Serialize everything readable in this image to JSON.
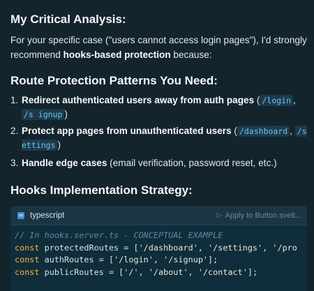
{
  "heading1": "My Critical Analysis:",
  "intro": {
    "before": "For your specific case (\"users cannot access login pages\"), I'd strongly recommend ",
    "bold": "hooks-based protection",
    "after": " because:"
  },
  "heading2": "Route Protection Patterns You Need:",
  "list": [
    {
      "num": "1.",
      "bold": "Redirect authenticated users away from auth pages",
      "open": " (",
      "code1": "/login",
      "sep": ", ",
      "code2": "/s ignup",
      "close": ")"
    },
    {
      "num": "2.",
      "bold": "Protect app pages from unauthenticated users",
      "open": " (",
      "code1": "/dashboard",
      "sep": ", ",
      "code2": "/s ettings",
      "close": ")"
    },
    {
      "num": "3.",
      "bold": "Handle edge cases",
      "rest": " (email verification, password reset, etc.)"
    }
  ],
  "heading3": "Hooks Implementation Strategy:",
  "code_block": {
    "language": "typescript",
    "apply_label": "Apply to Button.svelt...",
    "lines": [
      "// In hooks.server.ts - CONCEPTUAL EXAMPLE",
      "const protectedRoutes = ['/dashboard', '/settings', '/pro",
      "const authRoutes = ['/login', '/signup'];",
      "const publicRoutes = ['/', '/about', '/contact'];"
    ]
  }
}
